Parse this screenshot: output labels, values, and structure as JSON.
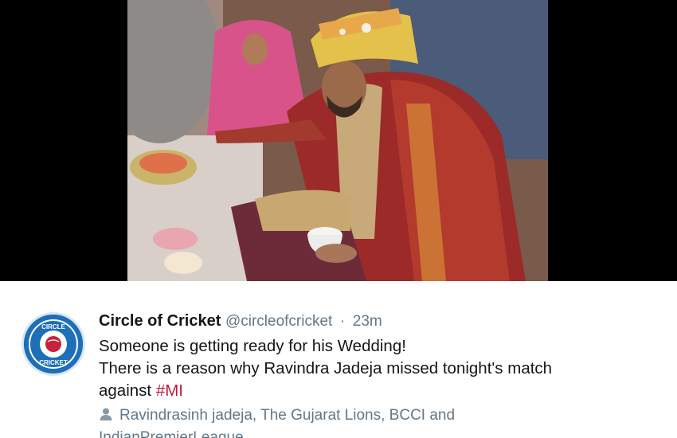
{
  "tweet": {
    "display_name": "Circle of Cricket",
    "handle": "@circleofcricket",
    "separator": "·",
    "time": "23m",
    "text_line1": "Someone is getting ready for his Wedding!",
    "text_line2": "There is a reason why Ravindra Jadeja missed tonight's match",
    "text_line3_prefix": "against ",
    "hashtag": "#MI",
    "tagged_line1": "Ravindrasinh jadeja, The Gujarat Lions, BCCI and",
    "tagged_line2": "IndianPremierLeague"
  },
  "avatar": {
    "logo_text_top": "CIRCLE",
    "logo_text_bottom": "CRICKET"
  },
  "colors": {
    "hashtag": "#b81d3b",
    "meta_gray": "#657786",
    "avatar_blue": "#1d6fb8"
  },
  "icons": {
    "tagged": "person-icon"
  }
}
